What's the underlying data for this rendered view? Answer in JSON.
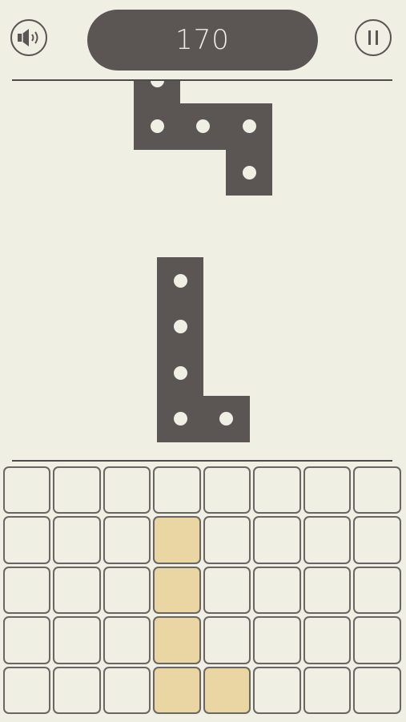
{
  "header": {
    "score": "170",
    "sound_icon": "speaker-volume-icon",
    "pause_icon": "pause-icon"
  },
  "colors": {
    "background": "#f0efe4",
    "piece": "#5b5654",
    "cell_border": "#6a6664",
    "placed_cell": "#ead6a2"
  },
  "pieces": [
    {
      "name": "z-shaped-piece",
      "cells": [
        [
          0,
          0
        ],
        [
          0,
          1
        ],
        [
          1,
          1
        ],
        [
          2,
          1
        ],
        [
          2,
          2
        ]
      ]
    },
    {
      "name": "l-shaped-piece",
      "cells": [
        [
          0,
          0
        ],
        [
          0,
          1
        ],
        [
          0,
          2
        ],
        [
          0,
          3
        ],
        [
          1,
          3
        ]
      ]
    }
  ],
  "board": {
    "columns": 8,
    "rows": 5,
    "filled": [
      [
        3,
        1
      ],
      [
        3,
        2
      ],
      [
        3,
        3
      ],
      [
        3,
        4
      ],
      [
        4,
        4
      ]
    ]
  }
}
